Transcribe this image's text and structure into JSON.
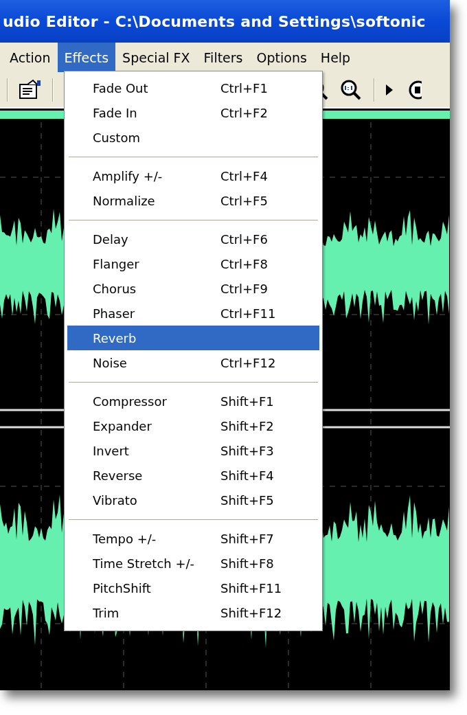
{
  "window": {
    "title": "udio Editor - C:\\Documents and Settings\\softonic"
  },
  "menubar": [
    {
      "label": "Action",
      "selected": false
    },
    {
      "label": "Effects",
      "selected": true
    },
    {
      "label": "Special FX",
      "selected": false
    },
    {
      "label": "Filters",
      "selected": false
    },
    {
      "label": "Options",
      "selected": false
    },
    {
      "label": "Help",
      "selected": false
    }
  ],
  "effects_menu": [
    [
      {
        "label": "Fade Out",
        "shortcut": "Ctrl+F1",
        "selected": false
      },
      {
        "label": "Fade In",
        "shortcut": "Ctrl+F2",
        "selected": false
      },
      {
        "label": "Custom",
        "selected": false
      }
    ],
    [
      {
        "label": "Amplify +/-",
        "shortcut": "Ctrl+F4",
        "selected": false
      },
      {
        "label": "Normalize",
        "shortcut": "Ctrl+F5",
        "selected": false
      }
    ],
    [
      {
        "label": "Delay",
        "shortcut": "Ctrl+F6",
        "selected": false
      },
      {
        "label": "Flanger",
        "shortcut": "Ctrl+F8",
        "selected": false
      },
      {
        "label": "Chorus",
        "shortcut": "Ctrl+F9",
        "selected": false
      },
      {
        "label": "Phaser",
        "shortcut": "Ctrl+F11",
        "selected": false
      },
      {
        "label": "Reverb",
        "selected": true
      },
      {
        "label": "Noise",
        "shortcut": "Ctrl+F12",
        "selected": false
      }
    ],
    [
      {
        "label": "Compressor",
        "shortcut": "Shift+F1",
        "selected": false
      },
      {
        "label": "Expander",
        "shortcut": "Shift+F2",
        "selected": false
      },
      {
        "label": "Invert",
        "shortcut": "Shift+F3",
        "selected": false
      },
      {
        "label": "Reverse",
        "shortcut": "Shift+F4",
        "selected": false
      },
      {
        "label": "Vibrato",
        "shortcut": "Shift+F5",
        "selected": false
      }
    ],
    [
      {
        "label": "Tempo +/-",
        "shortcut": "Shift+F7",
        "selected": false
      },
      {
        "label": "Time Stretch +/-",
        "shortcut": "Shift+F8",
        "selected": false
      },
      {
        "label": "PitchShift",
        "shortcut": "Shift+F11",
        "selected": false
      },
      {
        "label": "Trim",
        "shortcut": "Shift+F12",
        "selected": false
      }
    ]
  ]
}
